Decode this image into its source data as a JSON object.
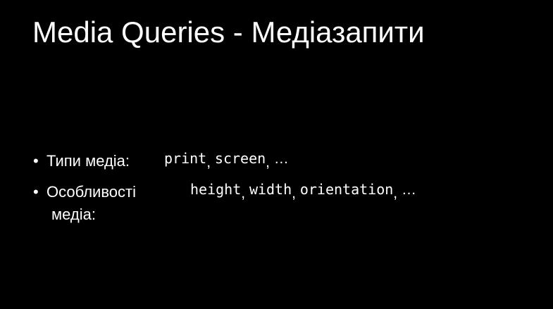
{
  "slide": {
    "title": "Media Queries - Медіазапити",
    "bullets": [
      {
        "dot": "•",
        "label": "Типи медіа:",
        "values": [
          "print",
          "screen"
        ],
        "separator": ",",
        "ellipsis": "…"
      },
      {
        "dot": "•",
        "label_line1": "Особливості",
        "label_line2": "медіа:",
        "values": [
          "height",
          "width",
          "orientation"
        ],
        "separator": ",",
        "ellipsis": "…"
      }
    ]
  },
  "colors": {
    "background": "#000000",
    "text": "#ffffff"
  }
}
